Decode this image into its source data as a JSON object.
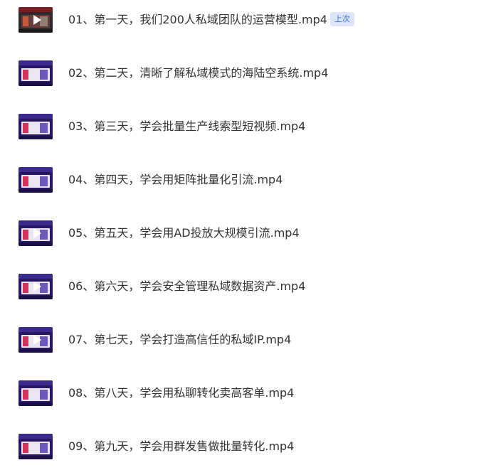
{
  "files": [
    {
      "title": "01、第一天，我们200人私域团队的运营模型.mp4",
      "badge": "上次"
    },
    {
      "title": "02、第二天，清晰了解私域模式的海陆空系统.mp4"
    },
    {
      "title": "03、第三天，学会批量生产线索型短视频.mp4"
    },
    {
      "title": "04、第四天，学会用矩阵批量化引流.mp4"
    },
    {
      "title": "05、第五天，学会用AD投放大规模引流.mp4"
    },
    {
      "title": "06、第六天，学会安全管理私域数据资产.mp4"
    },
    {
      "title": "07、第七天，学会打造高信任的私域IP.mp4"
    },
    {
      "title": "08、第八天，学会用私聊转化卖高客单.mp4"
    },
    {
      "title": "09、第九天，学会用群发售做批量转化.mp4"
    }
  ],
  "icons": {
    "thumbnail_overlay": "play-icon"
  },
  "colors": {
    "badge_text": "#3a6cd8",
    "badge_bg": "#dbe6fb",
    "thumb_bg": "#2a1764",
    "text": "#333333"
  }
}
